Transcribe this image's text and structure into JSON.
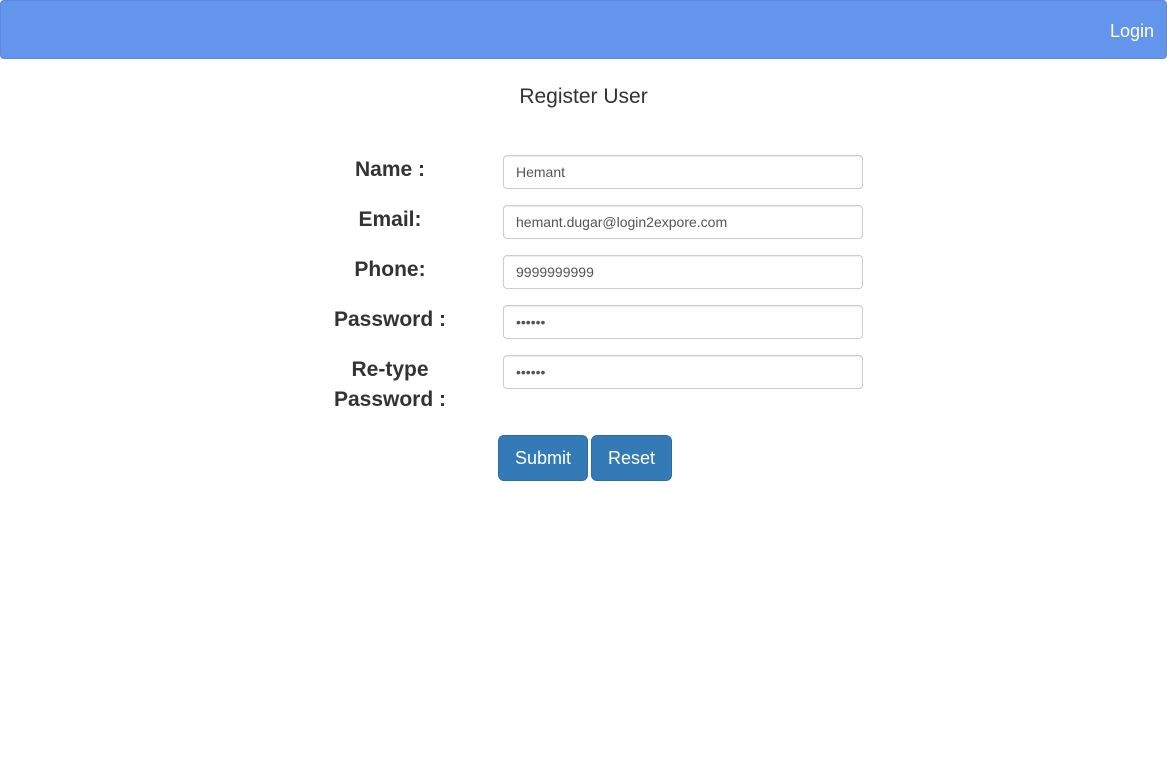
{
  "navbar": {
    "login_label": "Login",
    "background_color": "#6495ed"
  },
  "page": {
    "title": "Register User"
  },
  "form": {
    "name": {
      "label": "Name :",
      "value": "Hemant"
    },
    "email": {
      "label": "Email:",
      "value": "hemant.dugar@login2expore.com"
    },
    "phone": {
      "label": "Phone:",
      "value": "9999999999"
    },
    "password": {
      "label": "Password :",
      "value": "••••••"
    },
    "retype_password": {
      "label_line1": "Re-type",
      "label_line2": "Password :",
      "value": "••••••"
    },
    "submit_label": "Submit",
    "reset_label": "Reset",
    "button_color": "#337ab7"
  }
}
